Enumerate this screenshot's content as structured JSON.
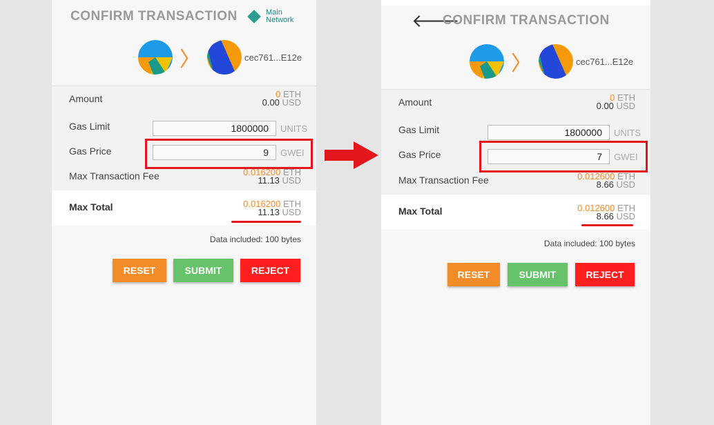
{
  "colors": {
    "accent_orange": "#f28c28",
    "submit_green": "#66c36c",
    "reject_red": "#ff1f1f",
    "highlight_red": "#e3161b",
    "network_teal": "#1f8a8a"
  },
  "left": {
    "title": "CONFIRM TRANSACTION",
    "network_line1": "Main",
    "network_line2": "Network",
    "address": "cec761...E12e",
    "amount_label": "Amount",
    "amount_eth": "0",
    "eth_unit": "ETH",
    "amount_usd": "0.00",
    "usd_unit": "USD",
    "gas_limit_label": "Gas Limit",
    "gas_limit_value": "1800000",
    "gas_limit_unit": "UNITS",
    "gas_price_label": "Gas Price",
    "gas_price_value": "9",
    "gas_price_unit": "GWEI",
    "max_fee_label": "Max Transaction Fee",
    "max_fee_eth": "0.016200",
    "max_fee_usd": "11.13",
    "max_total_label": "Max Total",
    "max_total_eth": "0.016200",
    "max_total_usd": "11.13",
    "data_included": "Data included: 100 bytes",
    "reset_label": "RESET",
    "submit_label": "SUBMIT",
    "reject_label": "REJECT"
  },
  "right": {
    "title": "CONFIRM TRANSACTION",
    "address": "cec761...E12e",
    "amount_label": "Amount",
    "amount_eth": "0",
    "eth_unit": "ETH",
    "amount_usd": "0.00",
    "usd_unit": "USD",
    "gas_limit_label": "Gas Limit",
    "gas_limit_value": "1800000",
    "gas_limit_unit": "UNITS",
    "gas_price_label": "Gas Price",
    "gas_price_value": "7",
    "gas_price_unit": "GWEI",
    "max_fee_label": "Max Transaction Fee",
    "max_fee_eth": "0.012600",
    "max_fee_usd": "8.66",
    "max_total_label": "Max Total",
    "max_total_eth": "0.012600",
    "max_total_usd": "8.66",
    "data_included": "Data included: 100 bytes",
    "reset_label": "RESET",
    "submit_label": "SUBMIT",
    "reject_label": "REJECT"
  }
}
